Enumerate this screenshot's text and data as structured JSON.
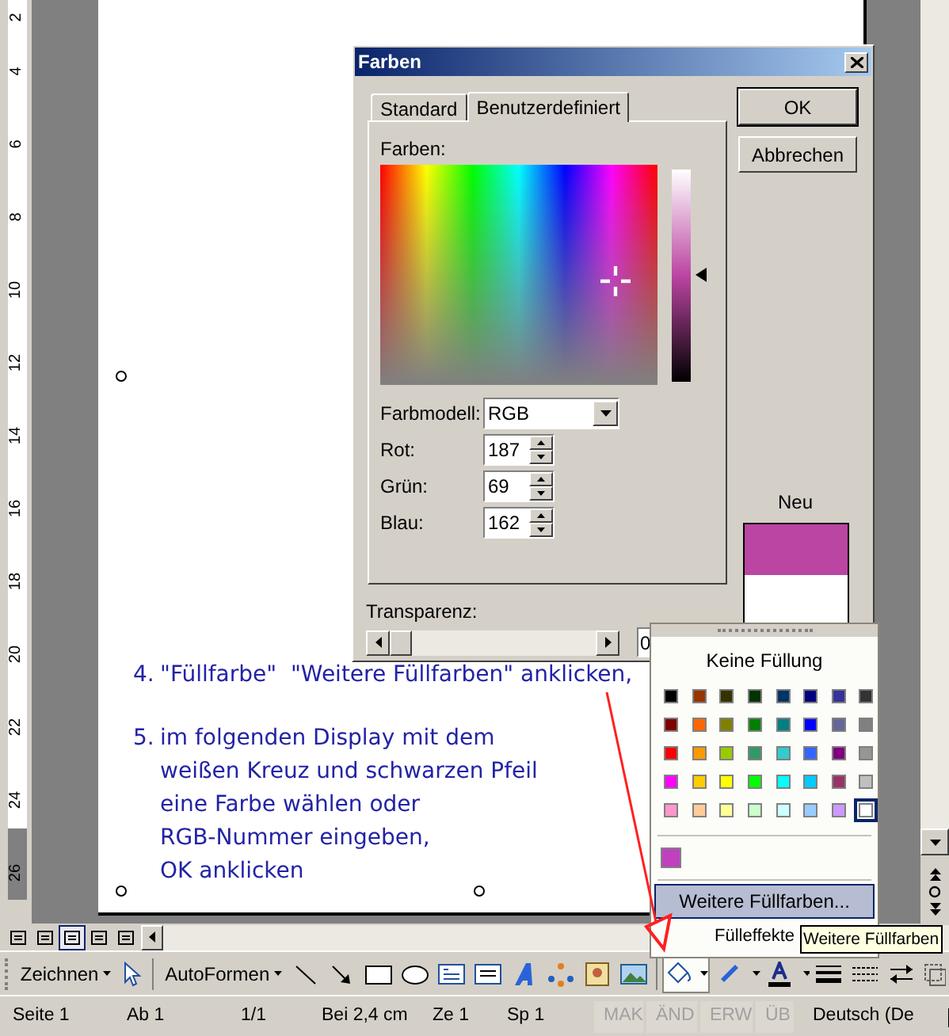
{
  "ruler": {
    "labels": [
      "2",
      "4",
      "6",
      "8",
      "10",
      "12",
      "14",
      "16",
      "18",
      "20",
      "22",
      "24",
      "26"
    ]
  },
  "document": {
    "steps": [
      {
        "number": "4.",
        "lines": [
          "\"Füllfarbe\"  \"Weitere Füllfarben\" anklicken,"
        ]
      },
      {
        "number": "5.",
        "lines": [
          "im folgenden Display mit dem",
          "weißen Kreuz und schwarzen Pfeil",
          "eine Farbe wählen oder",
          "RGB-Nummer eingeben,",
          "OK anklicken"
        ]
      }
    ]
  },
  "dialog": {
    "title": "Farben",
    "tabs": [
      {
        "label": "Standard",
        "selected": false
      },
      {
        "label": "Benutzerdefiniert",
        "selected": true
      }
    ],
    "colors_label": "Farben:",
    "model": {
      "label": "Farbmodell:",
      "value": "RGB"
    },
    "channels": [
      {
        "label": "Rot:",
        "value": "187"
      },
      {
        "label": "Grün:",
        "value": "69"
      },
      {
        "label": "Blau:",
        "value": "162"
      }
    ],
    "buttons": [
      "OK",
      "Abbrechen"
    ],
    "preview": {
      "label": "Neu",
      "color": "#bb45a2"
    },
    "transparency": {
      "label": "Transparenz:",
      "level": 0,
      "value": "0"
    }
  },
  "fill_menu": {
    "no_fill": "Keine Füllung",
    "swatches": [
      {
        "color": "#000000",
        "selected": false
      },
      {
        "color": "#993300",
        "selected": false
      },
      {
        "color": "#333300",
        "selected": false
      },
      {
        "color": "#003300",
        "selected": false
      },
      {
        "color": "#003366",
        "selected": false
      },
      {
        "color": "#000080",
        "selected": false
      },
      {
        "color": "#333399",
        "selected": false
      },
      {
        "color": "#333333",
        "selected": false
      },
      {
        "color": "#800000",
        "selected": false
      },
      {
        "color": "#ff6600",
        "selected": false
      },
      {
        "color": "#808000",
        "selected": false
      },
      {
        "color": "#008000",
        "selected": false
      },
      {
        "color": "#008080",
        "selected": false
      },
      {
        "color": "#0000ff",
        "selected": false
      },
      {
        "color": "#666699",
        "selected": false
      },
      {
        "color": "#808080",
        "selected": false
      },
      {
        "color": "#ff0000",
        "selected": false
      },
      {
        "color": "#ff9900",
        "selected": false
      },
      {
        "color": "#99cc00",
        "selected": false
      },
      {
        "color": "#339966",
        "selected": false
      },
      {
        "color": "#33cccc",
        "selected": false
      },
      {
        "color": "#3366ff",
        "selected": false
      },
      {
        "color": "#800080",
        "selected": false
      },
      {
        "color": "#969696",
        "selected": false
      },
      {
        "color": "#ff00ff",
        "selected": false
      },
      {
        "color": "#ffcc00",
        "selected": false
      },
      {
        "color": "#ffff00",
        "selected": false
      },
      {
        "color": "#00ff00",
        "selected": false
      },
      {
        "color": "#00ffff",
        "selected": false
      },
      {
        "color": "#00ccff",
        "selected": false
      },
      {
        "color": "#993366",
        "selected": false
      },
      {
        "color": "#c0c0c0",
        "selected": false
      },
      {
        "color": "#ff99cc",
        "selected": false
      },
      {
        "color": "#ffcc99",
        "selected": false
      },
      {
        "color": "#ffff99",
        "selected": false
      },
      {
        "color": "#ccffcc",
        "selected": false
      },
      {
        "color": "#ccffff",
        "selected": false
      },
      {
        "color": "#99ccff",
        "selected": false
      },
      {
        "color": "#cc99ff",
        "selected": false
      },
      {
        "color": "#ffffff",
        "selected": true
      }
    ],
    "recent": [
      {
        "color": "#c040c0"
      }
    ],
    "more": {
      "label": "Weitere Füllfarben...",
      "highlighted": true
    },
    "effects": "Fülleffekte"
  },
  "tooltip": "Weitere Füllfarben",
  "view_buttons": [
    {
      "selected": false
    },
    {
      "selected": false
    },
    {
      "selected": true
    },
    {
      "selected": false
    },
    {
      "selected": false
    }
  ],
  "toolbar": {
    "menus": [
      "Zeichnen",
      "AutoFormen"
    ],
    "fill_pressed": true
  },
  "status_bar": [
    {
      "text": "Seite 1",
      "disabled": false
    },
    {
      "text": "Ab 1",
      "disabled": false
    },
    {
      "text": "1/1",
      "disabled": false
    },
    {
      "text": "Bei 2,4 cm",
      "disabled": false
    },
    {
      "text": "Ze 1",
      "disabled": false
    },
    {
      "text": "Sp 1",
      "disabled": false
    },
    {
      "text": "MAK",
      "disabled": true
    },
    {
      "text": "ÄND",
      "disabled": true
    },
    {
      "text": "ERW",
      "disabled": true
    },
    {
      "text": "ÜB",
      "disabled": true
    },
    {
      "text": "Deutsch (De",
      "disabled": false
    }
  ]
}
